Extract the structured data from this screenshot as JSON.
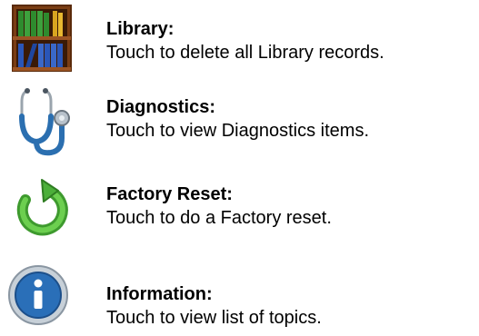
{
  "menu": {
    "items": [
      {
        "title": "Library:",
        "description": "Touch to delete all Library records.",
        "icon": "library-bookshelf-icon"
      },
      {
        "title": "Diagnostics:",
        "description": "Touch to view Diagnostics items.",
        "icon": "stethoscope-icon"
      },
      {
        "title": "Factory Reset:",
        "description": "Touch to do a Factory reset.",
        "icon": "reset-arrow-icon"
      },
      {
        "title": "Information:",
        "description": "Touch to view list of topics.",
        "icon": "info-icon"
      }
    ]
  },
  "colors": {
    "wood": "#8b4a1c",
    "wood_dark": "#5a2a0a",
    "book_green": "#2e8b2e",
    "book_blue": "#2a56b8",
    "book_gold": "#d9a520",
    "stethoscope": "#2b6fb0",
    "reset_green": "#4caf3a",
    "info_blue": "#2a6fb8",
    "info_ring": "#9aa7b3"
  }
}
